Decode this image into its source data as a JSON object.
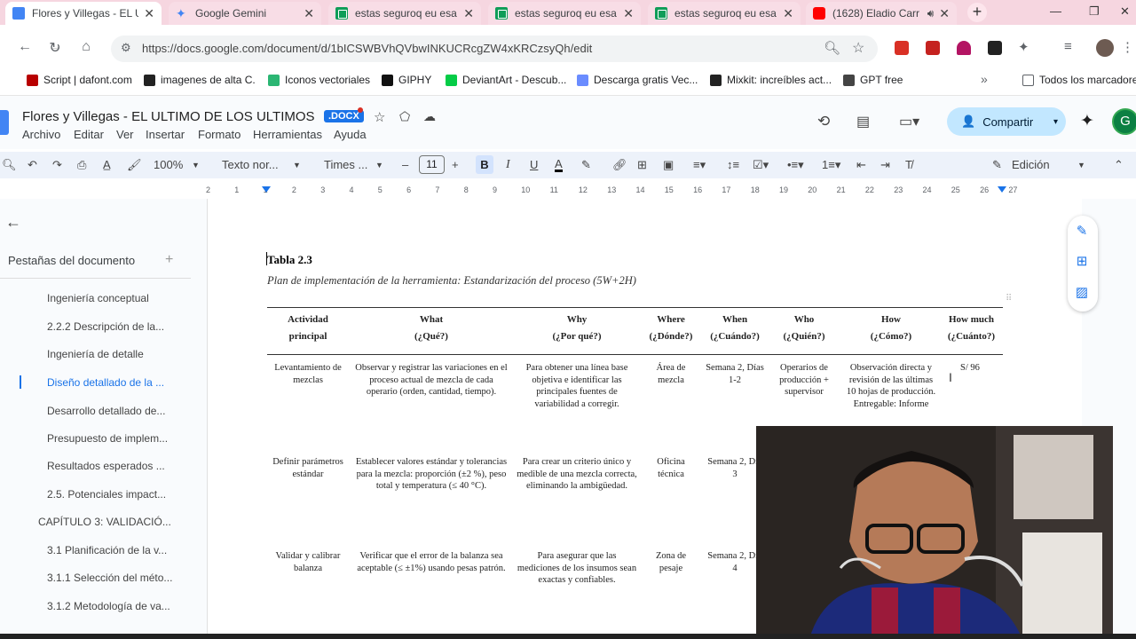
{
  "tabs": [
    {
      "title": "Flores y Villegas - EL ULTIMO",
      "icon": "docs-icon",
      "active": true
    },
    {
      "title": "Google Gemini",
      "icon": "gemini-icon",
      "active": false
    },
    {
      "title": "estas seguroq eu esa",
      "icon": "sheets-icon",
      "active": false
    },
    {
      "title": "estas seguroq eu esa",
      "icon": "sheets-icon",
      "active": false
    },
    {
      "title": "estas seguroq eu esa",
      "icon": "sheets-icon",
      "active": false
    },
    {
      "title": "(1628) Eladio Carr",
      "icon": "youtube-icon",
      "active": false
    }
  ],
  "address": {
    "url": "https://docs.google.com/document/d/1bICSWBVhQVbwINKUCRcgZW4xKRCzsyQh/edit"
  },
  "bookmarks": [
    {
      "label": "Script | dafont.com",
      "color": "#b80000"
    },
    {
      "label": "imagenes de alta C.",
      "color": "#222222"
    },
    {
      "label": "Iconos vectoriales",
      "color": "#2bb673"
    },
    {
      "label": "GIPHY",
      "color": "#111111"
    },
    {
      "label": "DeviantArt - Descub...",
      "color": "#05cc47"
    },
    {
      "label": "Descarga gratis Vec...",
      "color": "#6a8cff"
    },
    {
      "label": "Mixkit: increíbles act...",
      "color": "#222222"
    },
    {
      "label": "GPT free",
      "color": "#444444"
    },
    {
      "label": "Todos los marcadores",
      "color": "#5f6368"
    }
  ],
  "doc": {
    "title": "Flores y Villegas - EL ULTIMO DE LOS ULTIMOS",
    "badge": ".DOCX",
    "menu": [
      "Archivo",
      "Editar",
      "Ver",
      "Insertar",
      "Formato",
      "Herramientas",
      "Ayuda"
    ],
    "share_label": "Compartir",
    "avatar": "G"
  },
  "toolbar": {
    "zoom": "100%",
    "style": "Texto nor...",
    "font": "Times ...",
    "font_size": "11",
    "bold": "B",
    "italic": "I",
    "underline": "U",
    "mode": "Edición"
  },
  "ruler": [
    "2",
    "1",
    "1",
    "2",
    "3",
    "4",
    "5",
    "6",
    "7",
    "8",
    "9",
    "10",
    "11",
    "12",
    "13",
    "14",
    "15",
    "16",
    "17",
    "18",
    "19",
    "20",
    "21",
    "22",
    "23",
    "24",
    "25",
    "26",
    "27"
  ],
  "sidebar": {
    "heading": "Pestañas del documento",
    "items": [
      {
        "label": "Ingeniería conceptual",
        "indent": 2,
        "active": false
      },
      {
        "label": "2.2.2 Descripción de la...",
        "indent": 2,
        "active": false
      },
      {
        "label": "Ingeniería de detalle",
        "indent": 2,
        "active": false
      },
      {
        "label": "Diseño detallado de la ...",
        "indent": 2,
        "active": true
      },
      {
        "label": "Desarrollo detallado de...",
        "indent": 2,
        "active": false
      },
      {
        "label": "Presupuesto de implem...",
        "indent": 2,
        "active": false
      },
      {
        "label": "Resultados esperados ...",
        "indent": 2,
        "active": false
      },
      {
        "label": "2.5. Potenciales impact...",
        "indent": 2,
        "active": false
      },
      {
        "label": "CAPÍTULO 3: VALIDACIÓ...",
        "indent": 1,
        "active": false
      },
      {
        "label": "3.1 Planificación de la v...",
        "indent": 2,
        "active": false
      },
      {
        "label": "3.1.1 Selección del méto...",
        "indent": 2,
        "active": false
      },
      {
        "label": "3.1.2 Metodología de va...",
        "indent": 2,
        "active": false
      }
    ]
  },
  "table": {
    "title": "Tabla 2.3",
    "subtitle": "Plan de implementación de la herramienta: Estandarización del proceso (5W+2H)",
    "headers": [
      [
        "Actividad",
        "principal"
      ],
      [
        "What",
        "(¿Qué?)"
      ],
      [
        "Why",
        "(¿Por qué?)"
      ],
      [
        "Where",
        "(¿Dónde?)"
      ],
      [
        "When",
        "(¿Cuándo?)"
      ],
      [
        "Who",
        "(¿Quién?)"
      ],
      [
        "How",
        "(¿Cómo?)"
      ],
      [
        "How much",
        "(¿Cuánto?)"
      ]
    ],
    "rows": [
      [
        "Levantamiento de mezclas",
        "Observar y registrar las variaciones en el proceso actual de mezcla de cada operario (orden, cantidad, tiempo).",
        "Para obtener una línea base objetiva e identificar las principales fuentes de variabilidad a corregir.",
        "Área de mezcla",
        "Semana 2, Días 1-2",
        "Operarios de producción + supervisor",
        "Observación directa y revisión de las últimas 10 hojas de producción. Entregable: Informe",
        "S/ 96"
      ],
      [
        "Definir parámetros estándar",
        "Establecer valores estándar y tolerancias para la mezcla: proporción (±2 %), peso total y temperatura (≤ 40 °C).",
        "Para crear un criterio único y medible de una mezcla correcta, eliminando la ambigüedad.",
        "Oficina técnica",
        "Semana 2, Día 3",
        "",
        "",
        ""
      ],
      [
        "Validar y calibrar balanza",
        "Verificar que el error de la balanza sea aceptable (≤ ±1%) usando pesas patrón.",
        "Para asegurar que las mediciones de los insumos sean exactas y confiables.",
        "Zona de pesaje",
        "Semana 2, Día 4",
        "",
        "",
        ""
      ]
    ]
  }
}
